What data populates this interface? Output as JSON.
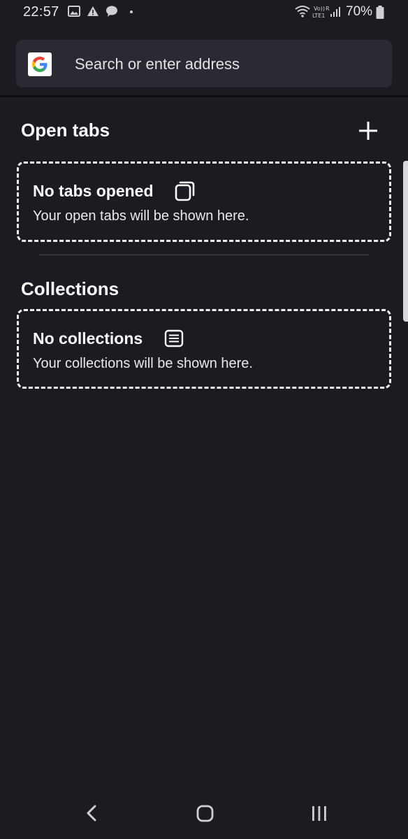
{
  "status_bar": {
    "time": "22:57",
    "battery": "70%",
    "icons": [
      "image-icon",
      "warning-icon",
      "chat-bubble-icon",
      "wifi-icon",
      "volte-lte-icon",
      "signal-icon",
      "battery-icon"
    ]
  },
  "toolbar": {
    "search_placeholder": "Search or enter address",
    "search_engine_icon": "google-logo-icon"
  },
  "open_tabs": {
    "title": "Open tabs",
    "add_icon": "plus-icon",
    "empty_title": "No tabs opened",
    "empty_description": "Your open tabs will be shown here.",
    "empty_icon": "tabs-icon"
  },
  "collections": {
    "title": "Collections",
    "empty_title": "No collections",
    "empty_description": "Your collections will be shown here.",
    "empty_icon": "collection-icon"
  },
  "nav_bar": {
    "icons": [
      "back-icon",
      "home-icon",
      "recents-icon"
    ]
  },
  "colors": {
    "background": "#1c1b22",
    "url_bar": "#2b2a33",
    "text": "#fbfbfe"
  }
}
